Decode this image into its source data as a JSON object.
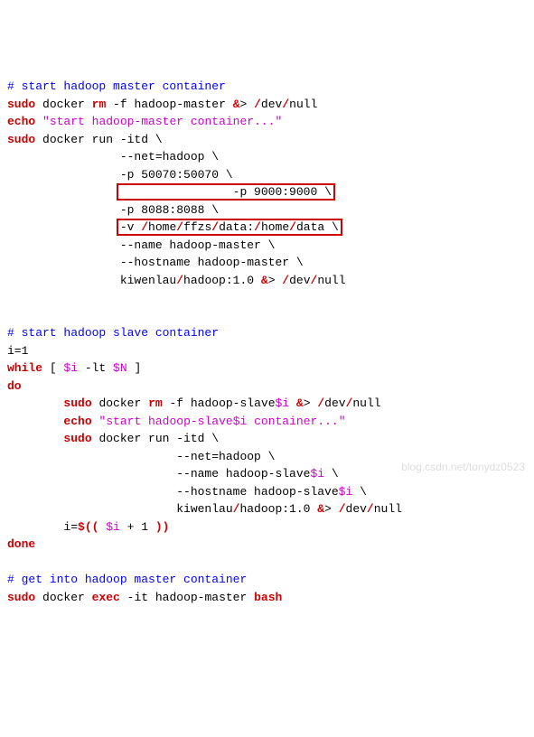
{
  "c1": "# start hadoop master container",
  "l2": {
    "sudo": "sudo",
    "docker": " docker ",
    "rm": "rm",
    "f": " -f hadoop-master ",
    "amp": "&",
    "gt": "> ",
    "slash1": "/",
    "dev": "dev",
    "slash2": "/",
    "null": "null"
  },
  "l3": {
    "echo": "echo",
    "sp": " ",
    "str": "\"start hadoop-master container...\""
  },
  "l4": {
    "sudo": "sudo",
    "rest": " docker run -itd \\"
  },
  "l5": "                --net=hadoop \\",
  "l6": "                -p 50070:50070 \\",
  "l7": "                -p 9000:9000 \\",
  "l8": "                -p 8088:8088 \\",
  "l9": {
    "pad": "                ",
    "text": "-v /home/ffzs/data:/home/data \\"
  },
  "l10": "                --name hadoop-master \\",
  "l11": "                --hostname hadoop-master \\",
  "l12": {
    "pad": "                kiwenlau",
    "s1": "/",
    "mid": "hadoop:1.0 ",
    "amp": "&",
    "gt": "> ",
    "s2": "/",
    "dev": "dev",
    "s3": "/",
    "null": "null"
  },
  "blank1": "",
  "blank2": "",
  "c2": "# start hadoop slave container",
  "l15": "i=1",
  "l16": {
    "while": "while",
    "b1": " [ ",
    "v1": "$i",
    "mid": " -lt ",
    "v2": "$N",
    "b2": " ]"
  },
  "l17": "do",
  "l18": {
    "pad": "        ",
    "sudo": "sudo",
    "mid": " docker ",
    "rm": "rm",
    "rest": " -f hadoop-slave",
    "v": "$i",
    "sp": " ",
    "amp": "&",
    "gt": "> ",
    "s1": "/",
    "dev": "dev",
    "s2": "/",
    "null": "null"
  },
  "l19": {
    "pad": "        ",
    "echo": "echo",
    "sp": " ",
    "q1": "\"start hadoop-slave",
    "v": "$i",
    "q2": " container...\""
  },
  "l20": {
    "pad": "        ",
    "sudo": "sudo",
    "rest": " docker run -itd \\"
  },
  "l21": "                        --net=hadoop \\",
  "l22": {
    "pad": "                        --name hadoop-slave",
    "v": "$i",
    "rest": " \\"
  },
  "l23": {
    "pad": "                        --hostname hadoop-slave",
    "v": "$i",
    "rest": " \\"
  },
  "l24": {
    "pad": "                        kiwenlau",
    "s1": "/",
    "mid": "hadoop:1.0 ",
    "amp": "&",
    "gt": "> ",
    "s2": "/",
    "dev": "dev",
    "s3": "/",
    "null": "null"
  },
  "l25": {
    "pad": "        i=",
    "d1": "$",
    "p1": "((",
    "sp1": " ",
    "v": "$i",
    "mid": " + 1 ",
    "p2": "))"
  },
  "l26": "done",
  "blank3": "",
  "c3": "# get into hadoop master container",
  "l28": {
    "sudo": "sudo",
    "mid": " docker ",
    "exec": "exec",
    "rest": " -it hadoop-master ",
    "bash": "bash"
  },
  "watermark": "blog.csdn.net/tonydz0523"
}
